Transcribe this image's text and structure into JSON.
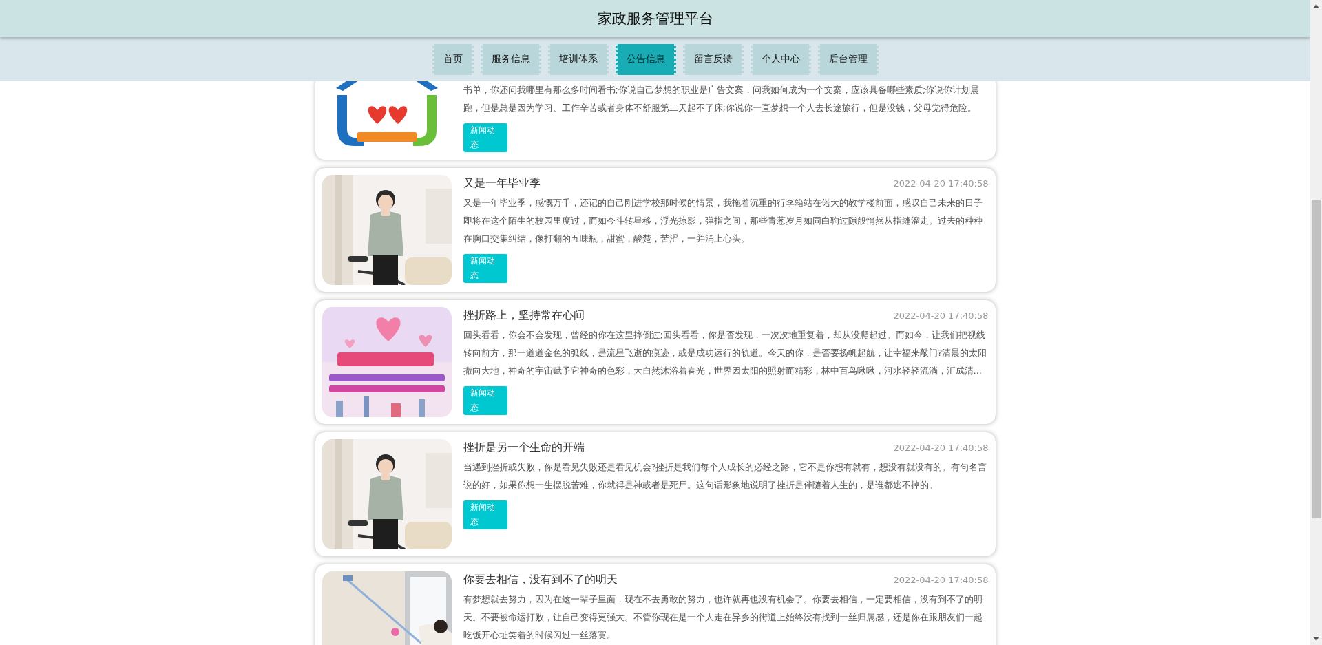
{
  "header": {
    "title": "家政服务管理平台"
  },
  "nav": [
    {
      "label": "首页",
      "selected": false
    },
    {
      "label": "服务信息",
      "selected": false
    },
    {
      "label": "培训体系",
      "selected": false
    },
    {
      "label": "公告信息",
      "selected": true
    },
    {
      "label": "留言反馈",
      "selected": false
    },
    {
      "label": "个人中心",
      "selected": false
    },
    {
      "label": "后台管理",
      "selected": false
    }
  ],
  "articles": [
    {
      "text": "书单，你还问我哪里有那么多时间看书;你说自己梦想的职业是广告文案，问我如何成为一个文案，应该具备哪些素质;你说你计划晨跑，但是总是因为学习、工作辛苦或者身体不舒服第二天起不了床;你说你一直梦想一个人去长途旅行，但是没钱，父母觉得危险。",
      "tag": "新闻动态"
    },
    {
      "title": "又是一年毕业季",
      "date": "2022-04-20 17:40:58",
      "text": "又是一年毕业季，感慨万千，还记的自己刚进学校那时候的情景，我拖着沉重的行李箱站在偌大的教学楼前面，感叹自己未来的日子即将在这个陌生的校园里度过，而如今斗转星移，浮光掠影，弹指之间，那些青葱岁月如同白驹过隙般悄然从指缝溜走。过去的种种在胸口交集纠结，像打翻的五味瓶，甜蜜，酸楚，苦涩，一并涌上心头。",
      "tag": "新闻动态"
    },
    {
      "title": "挫折路上，坚持常在心间",
      "date": "2022-04-20 17:40:58",
      "text": "回头看看，你会不会发现，曾经的你在这里摔倒过;回头看看，你是否发现，一次次地重复着，却从没爬起过。而如今，让我们把视线转向前方，那一道道金色的弧线，是流星飞逝的痕迹，或是成功运行的轨道。今天的你，是否要扬帆起航，让幸福来敲门?清晨的太阳撒向大地，神奇的宇宙赋予它神奇的色彩，大自然沐浴着春光，世界因太阳的照射而精彩，林中百鸟啾啾，河水轻轻流淌，汇成清...",
      "tag": "新闻动态"
    },
    {
      "title": "挫折是另一个生命的开端",
      "date": "2022-04-20 17:40:58",
      "text": "当遇到挫折或失败，你是看见失败还是看见机会?挫折是我们每个人成长的必经之路，它不是你想有就有，想没有就没有的。有句名言说的好，如果你想一生摆脱苦难，你就得是神或者是死尸。这句话形象地说明了挫折是伴随着人生的，是谁都逃不掉的。",
      "tag": "新闻动态"
    },
    {
      "title": "你要去相信，没有到不了的明天",
      "date": "2022-04-20 17:40:58",
      "text": "有梦想就去努力，因为在这一辈子里面，现在不去勇敢的努力，也许就再也没有机会了。你要去相信，一定要相信，没有到不了的明天。不要被命运打败，让自己变得更强大。不管你现在是一个人走在异乡的街道上始终没有找到一丝归属感，还是你在跟朋友们一起吃饭开心址笑着的时候闪过一丝落寞。"
    }
  ]
}
